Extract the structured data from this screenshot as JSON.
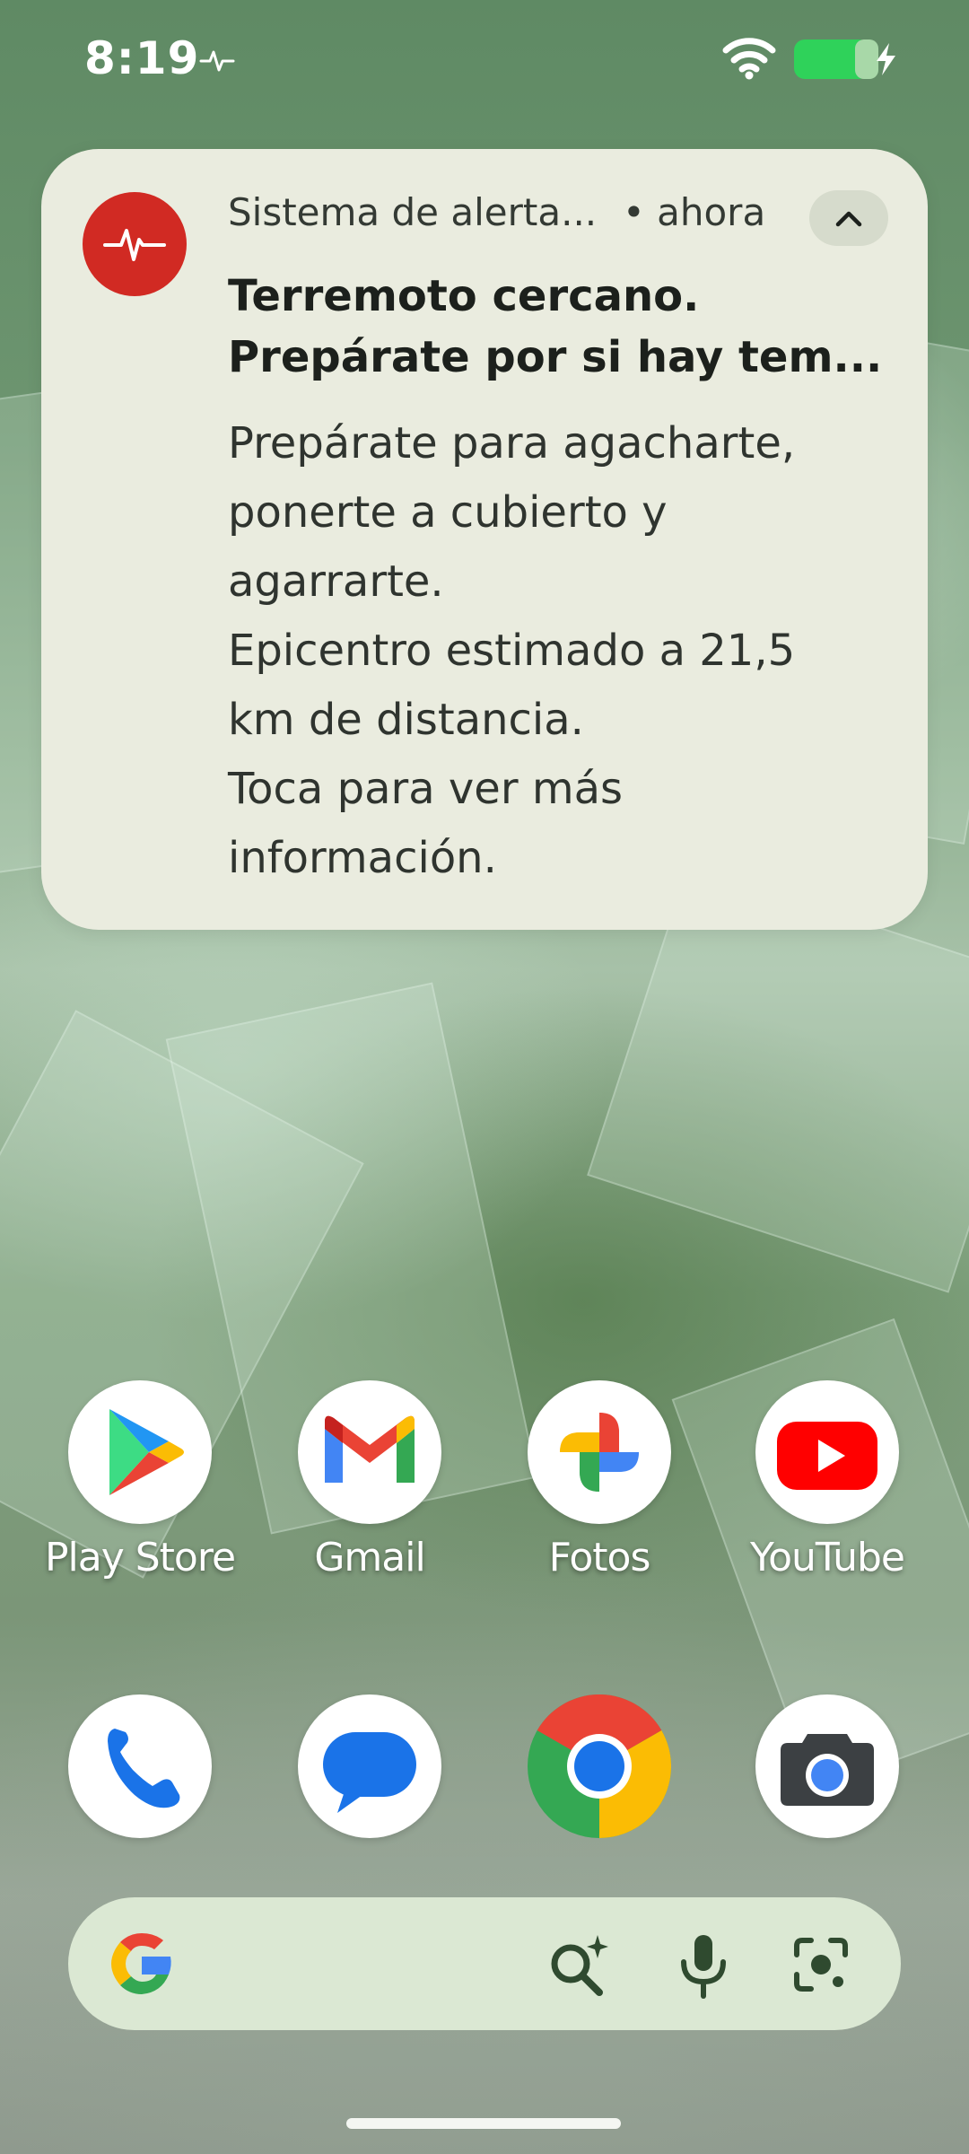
{
  "status_bar": {
    "time": "8:19",
    "icons": [
      "pulse-icon",
      "wifi-icon",
      "battery-charging-icon"
    ]
  },
  "notification": {
    "app_name": "Sistema de alerta...",
    "time": "• ahora",
    "title_lines": [
      "Terremoto cercano.",
      "Prepárate por si hay tem..."
    ],
    "body_lines": [
      "Prepárate para agacharte,",
      "ponerte a cubierto y",
      "agarrarte.",
      "Epicentro estimado a 21,5",
      "km de distancia.",
      "Toca para ver más",
      "información."
    ],
    "accent_color": "#d12a23"
  },
  "apps_row1": [
    {
      "label": "Play Store",
      "icon": "play-store-icon"
    },
    {
      "label": "Gmail",
      "icon": "gmail-icon"
    },
    {
      "label": "Fotos",
      "icon": "photos-icon"
    },
    {
      "label": "YouTube",
      "icon": "youtube-icon"
    }
  ],
  "dock": [
    {
      "icon": "phone-icon"
    },
    {
      "icon": "messages-icon"
    },
    {
      "icon": "chrome-icon"
    },
    {
      "icon": "camera-icon"
    }
  ],
  "search_bar": {
    "icons": [
      "google-logo-icon",
      "ai-search-icon",
      "microphone-icon",
      "lens-icon"
    ]
  }
}
